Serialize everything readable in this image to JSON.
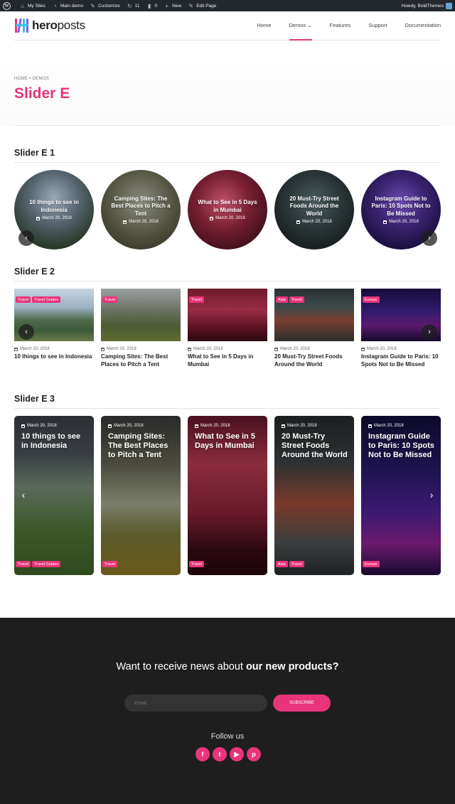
{
  "adminbar": {
    "my_sites": "My Sites",
    "main_demo": "Main demo",
    "customize": "Customize",
    "updates": "11",
    "comments": "0",
    "new": "New",
    "edit_page": "Edit Page",
    "howdy": "Howdy, BoldThemes"
  },
  "header": {
    "logo_bold": "hero",
    "logo_light": "posts",
    "nav": [
      "Home",
      "Demos",
      "Features",
      "Support",
      "Documentation"
    ],
    "active_nav": "Demos"
  },
  "page": {
    "breadcrumb": "HOME • DEMOS",
    "title": "Slider E"
  },
  "slider1": {
    "title": "Slider E 1",
    "items": [
      {
        "title": "10 things to see in Indonesia",
        "date": "March 20, 2018"
      },
      {
        "title": "Camping Sites: The Best Places to Pitch a Tent",
        "date": "March 20, 2018"
      },
      {
        "title": "What to See in 5 Days in Mumbai",
        "date": "March 20, 2018"
      },
      {
        "title": "20 Must-Try Street Foods Around the World",
        "date": "March 20, 2018"
      },
      {
        "title": "Instagram Guide to Paris: 10 Spots Not to Be Missed",
        "date": "March 20, 2018"
      }
    ]
  },
  "slider2": {
    "title": "Slider E 2",
    "items": [
      {
        "title": "10 things to see in Indonesia",
        "date": "March 20, 2018",
        "tags": [
          "Travel",
          "Travel Guides"
        ]
      },
      {
        "title": "Camping Sites: The Best Places to Pitch a Tent",
        "date": "March 20, 2018",
        "tags": [
          "Travel"
        ]
      },
      {
        "title": "What to See in 5 Days in Mumbai",
        "date": "March 20, 2018",
        "tags": [
          "Travel"
        ]
      },
      {
        "title": "20 Must-Try Street Foods Around the World",
        "date": "March 20, 2018",
        "tags": [
          "Asia",
          "Travel"
        ]
      },
      {
        "title": "Instagram Guide to Paris: 10 Spots Not to Be Missed",
        "date": "March 20, 2018",
        "tags": [
          "Europe"
        ]
      }
    ]
  },
  "slider3": {
    "title": "Slider E 3",
    "items": [
      {
        "title": "10 things to see in Indonesia",
        "date": "March 20, 2018",
        "tags": [
          "Travel",
          "Travel Guides"
        ]
      },
      {
        "title": "Camping Sites: The Best Places to Pitch a Tent",
        "date": "March 20, 2018",
        "tags": [
          "Travel"
        ]
      },
      {
        "title": "What to See in 5 Days in Mumbai",
        "date": "March 20, 2018",
        "tags": [
          "Travel"
        ]
      },
      {
        "title": "20 Must-Try Street Foods Around the World",
        "date": "March 20, 2018",
        "tags": [
          "Asia",
          "Travel"
        ]
      },
      {
        "title": "Instagram Guide to Paris: 10 Spots Not to Be Missed",
        "date": "March 20, 2018",
        "tags": [
          "Europe"
        ]
      }
    ]
  },
  "footer": {
    "newsletter_text": "Want to receive news about ",
    "newsletter_bold": "our new products?",
    "email_placeholder": "email",
    "subscribe_label": "SUBSCRIBE",
    "follow_label": "Follow us",
    "socials": [
      {
        "icon": "facebook-icon",
        "glyph": "f"
      },
      {
        "icon": "twitter-icon",
        "glyph": "t"
      },
      {
        "icon": "youtube-icon",
        "glyph": "▶"
      },
      {
        "icon": "pinterest-icon",
        "glyph": "p"
      }
    ]
  },
  "colors": {
    "accent": "#e8347a",
    "footer_bg": "#1e1e1e",
    "adminbar_bg": "#23282d"
  }
}
